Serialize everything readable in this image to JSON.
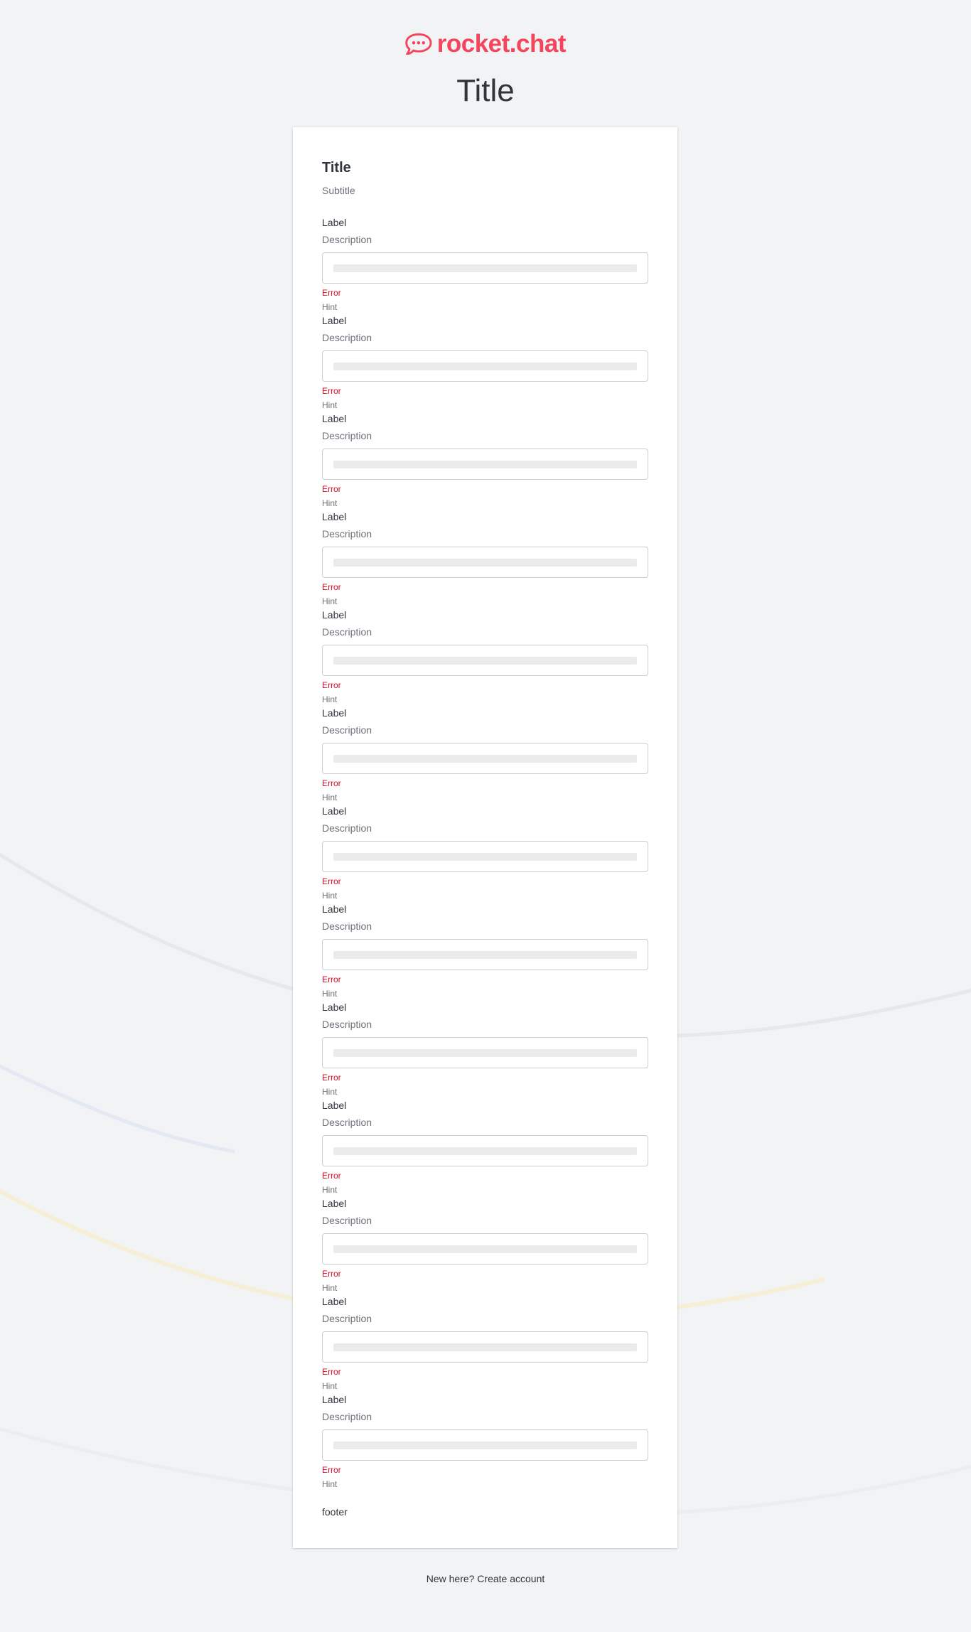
{
  "brand": {
    "logo_text": "rocket.chat",
    "logo_icon": "rocket-chat-logo-icon",
    "color": "#f5455c"
  },
  "page": {
    "title": "Title"
  },
  "form": {
    "title": "Title",
    "subtitle": "Subtitle",
    "fields": [
      {
        "label": "Label",
        "description": "Description",
        "error": "Error",
        "hint": "Hint"
      },
      {
        "label": "Label",
        "description": "Description",
        "error": "Error",
        "hint": "Hint"
      },
      {
        "label": "Label",
        "description": "Description",
        "error": "Error",
        "hint": "Hint"
      },
      {
        "label": "Label",
        "description": "Description",
        "error": "Error",
        "hint": "Hint"
      },
      {
        "label": "Label",
        "description": "Description",
        "error": "Error",
        "hint": "Hint"
      },
      {
        "label": "Label",
        "description": "Description",
        "error": "Error",
        "hint": "Hint"
      },
      {
        "label": "Label",
        "description": "Description",
        "error": "Error",
        "hint": "Hint"
      },
      {
        "label": "Label",
        "description": "Description",
        "error": "Error",
        "hint": "Hint"
      },
      {
        "label": "Label",
        "description": "Description",
        "error": "Error",
        "hint": "Hint"
      },
      {
        "label": "Label",
        "description": "Description",
        "error": "Error",
        "hint": "Hint"
      },
      {
        "label": "Label",
        "description": "Description",
        "error": "Error",
        "hint": "Hint"
      },
      {
        "label": "Label",
        "description": "Description",
        "error": "Error",
        "hint": "Hint"
      },
      {
        "label": "Label",
        "description": "Description",
        "error": "Error",
        "hint": "Hint"
      }
    ],
    "footer": "footer"
  },
  "bottom": {
    "create_account_link": "New here? Create account"
  },
  "colors": {
    "background": "#f2f3f5",
    "error": "#d40c26",
    "hint": "#6c727a",
    "text": "#2f343d"
  }
}
